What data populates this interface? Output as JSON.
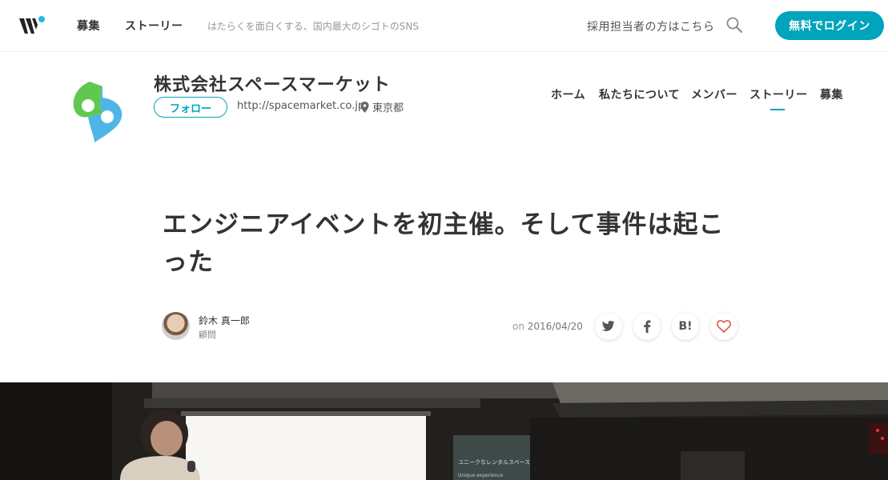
{
  "header": {
    "nav": [
      "募集",
      "ストーリー"
    ],
    "tagline": "はたらくを面白くする、国内最大のシゴトのSNS",
    "recruiter_link": "採用担当者の方はこちら",
    "login_button": "無料でログイン",
    "search_icon": "search-icon",
    "brand_color": "#00a4bb"
  },
  "company": {
    "name": "株式会社スペースマーケット",
    "follow_button": "フォロー",
    "url": "http://spacemarket.co.jp",
    "location": "東京都",
    "nav": [
      "ホーム",
      "私たちについて",
      "メンバー",
      "ストーリー",
      "募集"
    ],
    "active_nav": "ストーリー"
  },
  "article": {
    "title": "エンジニアイベントを初主催。そして事件は起こった",
    "author_name": "鈴木 真一郎",
    "author_role": "顧問",
    "date_prefix": "on",
    "date": "2016/04/20",
    "share_icons": [
      "twitter-icon",
      "facebook-icon",
      "hatena-bookmark-icon",
      "heart-icon"
    ],
    "share_b_label": "B!",
    "hero_screen_text": "ユニークなレンタルスペースを\n簡単に貸し借り",
    "hero_screen_subtext": "Unique experience"
  }
}
